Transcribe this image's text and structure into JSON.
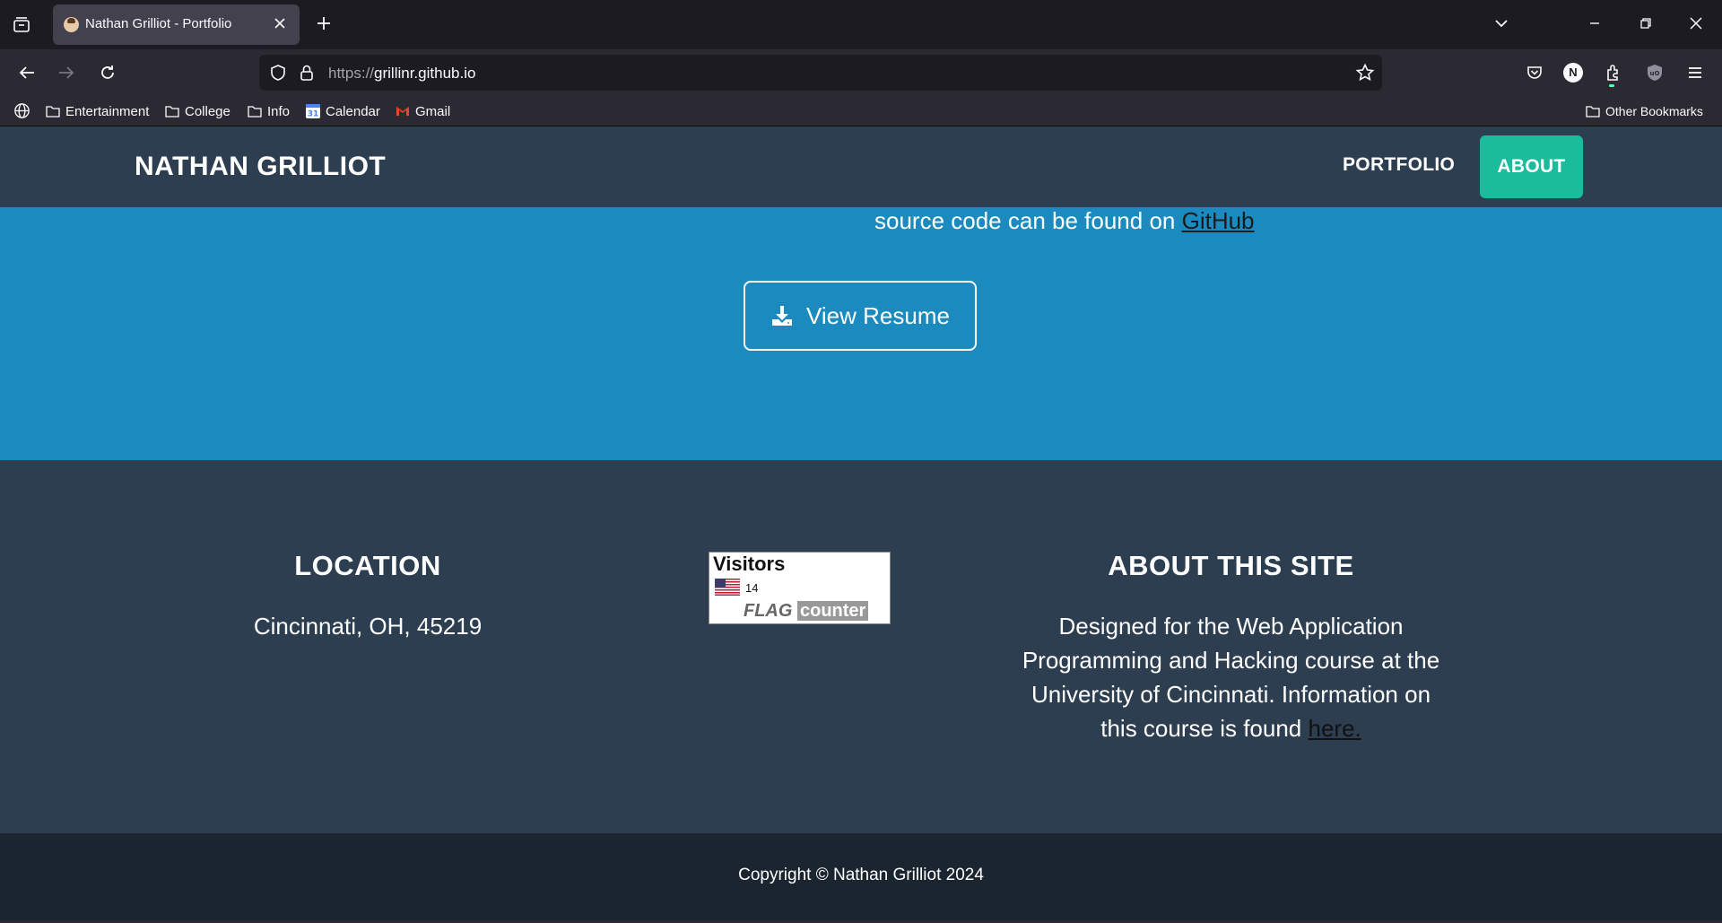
{
  "browser": {
    "tab_title": "Nathan Grilliot - Portfolio",
    "url_protocol": "https://",
    "url_host": "grillinr.github.io",
    "bookmarks": [
      {
        "label": "Entertainment",
        "icon": "folder-icon"
      },
      {
        "label": "College",
        "icon": "folder-icon"
      },
      {
        "label": "Info",
        "icon": "folder-icon"
      },
      {
        "label": "Calendar",
        "icon": "calendar-icon"
      },
      {
        "label": "Gmail",
        "icon": "gmail-icon"
      }
    ],
    "other_bookmarks": "Other Bookmarks",
    "profile_initial": "N"
  },
  "site": {
    "brand": "NATHAN GRILLIOT",
    "nav": {
      "portfolio": "PORTFOLIO",
      "about": "ABOUT"
    },
    "about": {
      "source_text": "source code can be found on ",
      "source_link": "GitHub",
      "resume_button": "View Resume"
    },
    "footer": {
      "location_heading": "LOCATION",
      "location_text": "Cincinnati, OH, 45219",
      "visitors_title": "Visitors",
      "visitors_count": "14",
      "flag_counter_left": "FLAG",
      "flag_counter_right": "counter",
      "about_heading": "ABOUT THIS SITE",
      "about_text": "Designed for the Web Application Programming and Hacking course at the University of Cincinnati. Information on this course is found ",
      "about_link": "here."
    },
    "copyright": "Copyright © Nathan Grilliot 2024"
  },
  "colors": {
    "nav_bg": "#2c3e50",
    "accent": "#1abc9c",
    "about_bg": "#1b8bbf",
    "copyright_bg": "#1a252f"
  }
}
